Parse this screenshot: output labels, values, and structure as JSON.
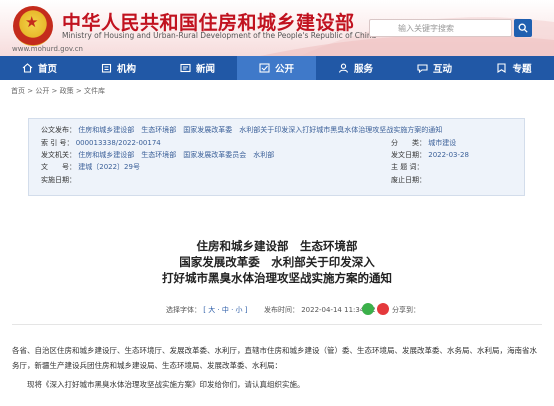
{
  "header": {
    "title": "中华人民共和国住房和城乡建设部",
    "subtitle": "Ministry of Housing and Urban-Rural Development of the People's Republic of China",
    "domain": "www.mohurd.gov.cn",
    "search_placeholder": "输入关键字搜索",
    "brand_color": "#c1121f",
    "nav_color": "#2158a6"
  },
  "nav": {
    "items": [
      {
        "label": "首页",
        "icon": "home-icon"
      },
      {
        "label": "机构",
        "icon": "building-icon"
      },
      {
        "label": "新闻",
        "icon": "news-icon"
      },
      {
        "label": "公开",
        "icon": "open-icon",
        "active": true
      },
      {
        "label": "服务",
        "icon": "person-icon"
      },
      {
        "label": "互动",
        "icon": "chat-icon"
      },
      {
        "label": "专题",
        "icon": "topic-icon"
      }
    ]
  },
  "breadcrumb": "首页 > 公开 > 政策 > 文件库",
  "meta": {
    "publisher_label": "公文发布：",
    "publisher_value": "住房和城乡建设部　生态环境部　国家发展改革委　水利部关于印发深入打好城市黑臭水体治理攻坚战实施方案的通知",
    "index_label": "索 引 号：",
    "index_value": "000013338/2022-00174",
    "category_label": "分　　类：",
    "category_value": "城市建设",
    "issuer_label": "发文机关：",
    "issuer_value": "住房和城乡建设部　生态环境部　国家发展改革委员会　水利部",
    "date_label": "发文日期：",
    "date_value": "2022-03-28",
    "doc_no_label": "文　　号：",
    "doc_no_value": "建城〔2022〕29号",
    "topic_label": "主 题 词：",
    "topic_value": "",
    "effective_label": "实施日期：",
    "effective_value": "",
    "expire_label": "废止日期：",
    "expire_value": ""
  },
  "article": {
    "title_lines": [
      "住房和城乡建设部　生态环境部",
      "国家发展改革委　水利部关于印发深入",
      "打好城市黑臭水体治理攻坚战实施方案的通知"
    ],
    "font_label": "选择字体：",
    "font_sizes": "[ 大 · 中 · 小 ]",
    "publish_label": "发布时间：",
    "publish_time": "2022-04-14 11:34:22",
    "share_label": "分享到：",
    "body": [
      "各省、自治区住房和城乡建设厅、生态环境厅、发展改革委、水利厅，直辖市住房和城乡建设（管）委、生态环境局、发展改革委、水务局、水利局，海南省水务厅，新疆生产建设兵团住房和城乡建设局、生态环境局、发展改革委、水利局：",
      "现将《深入打好城市黑臭水体治理攻坚战实施方案》印发给你们，请认真组织实施。"
    ]
  }
}
